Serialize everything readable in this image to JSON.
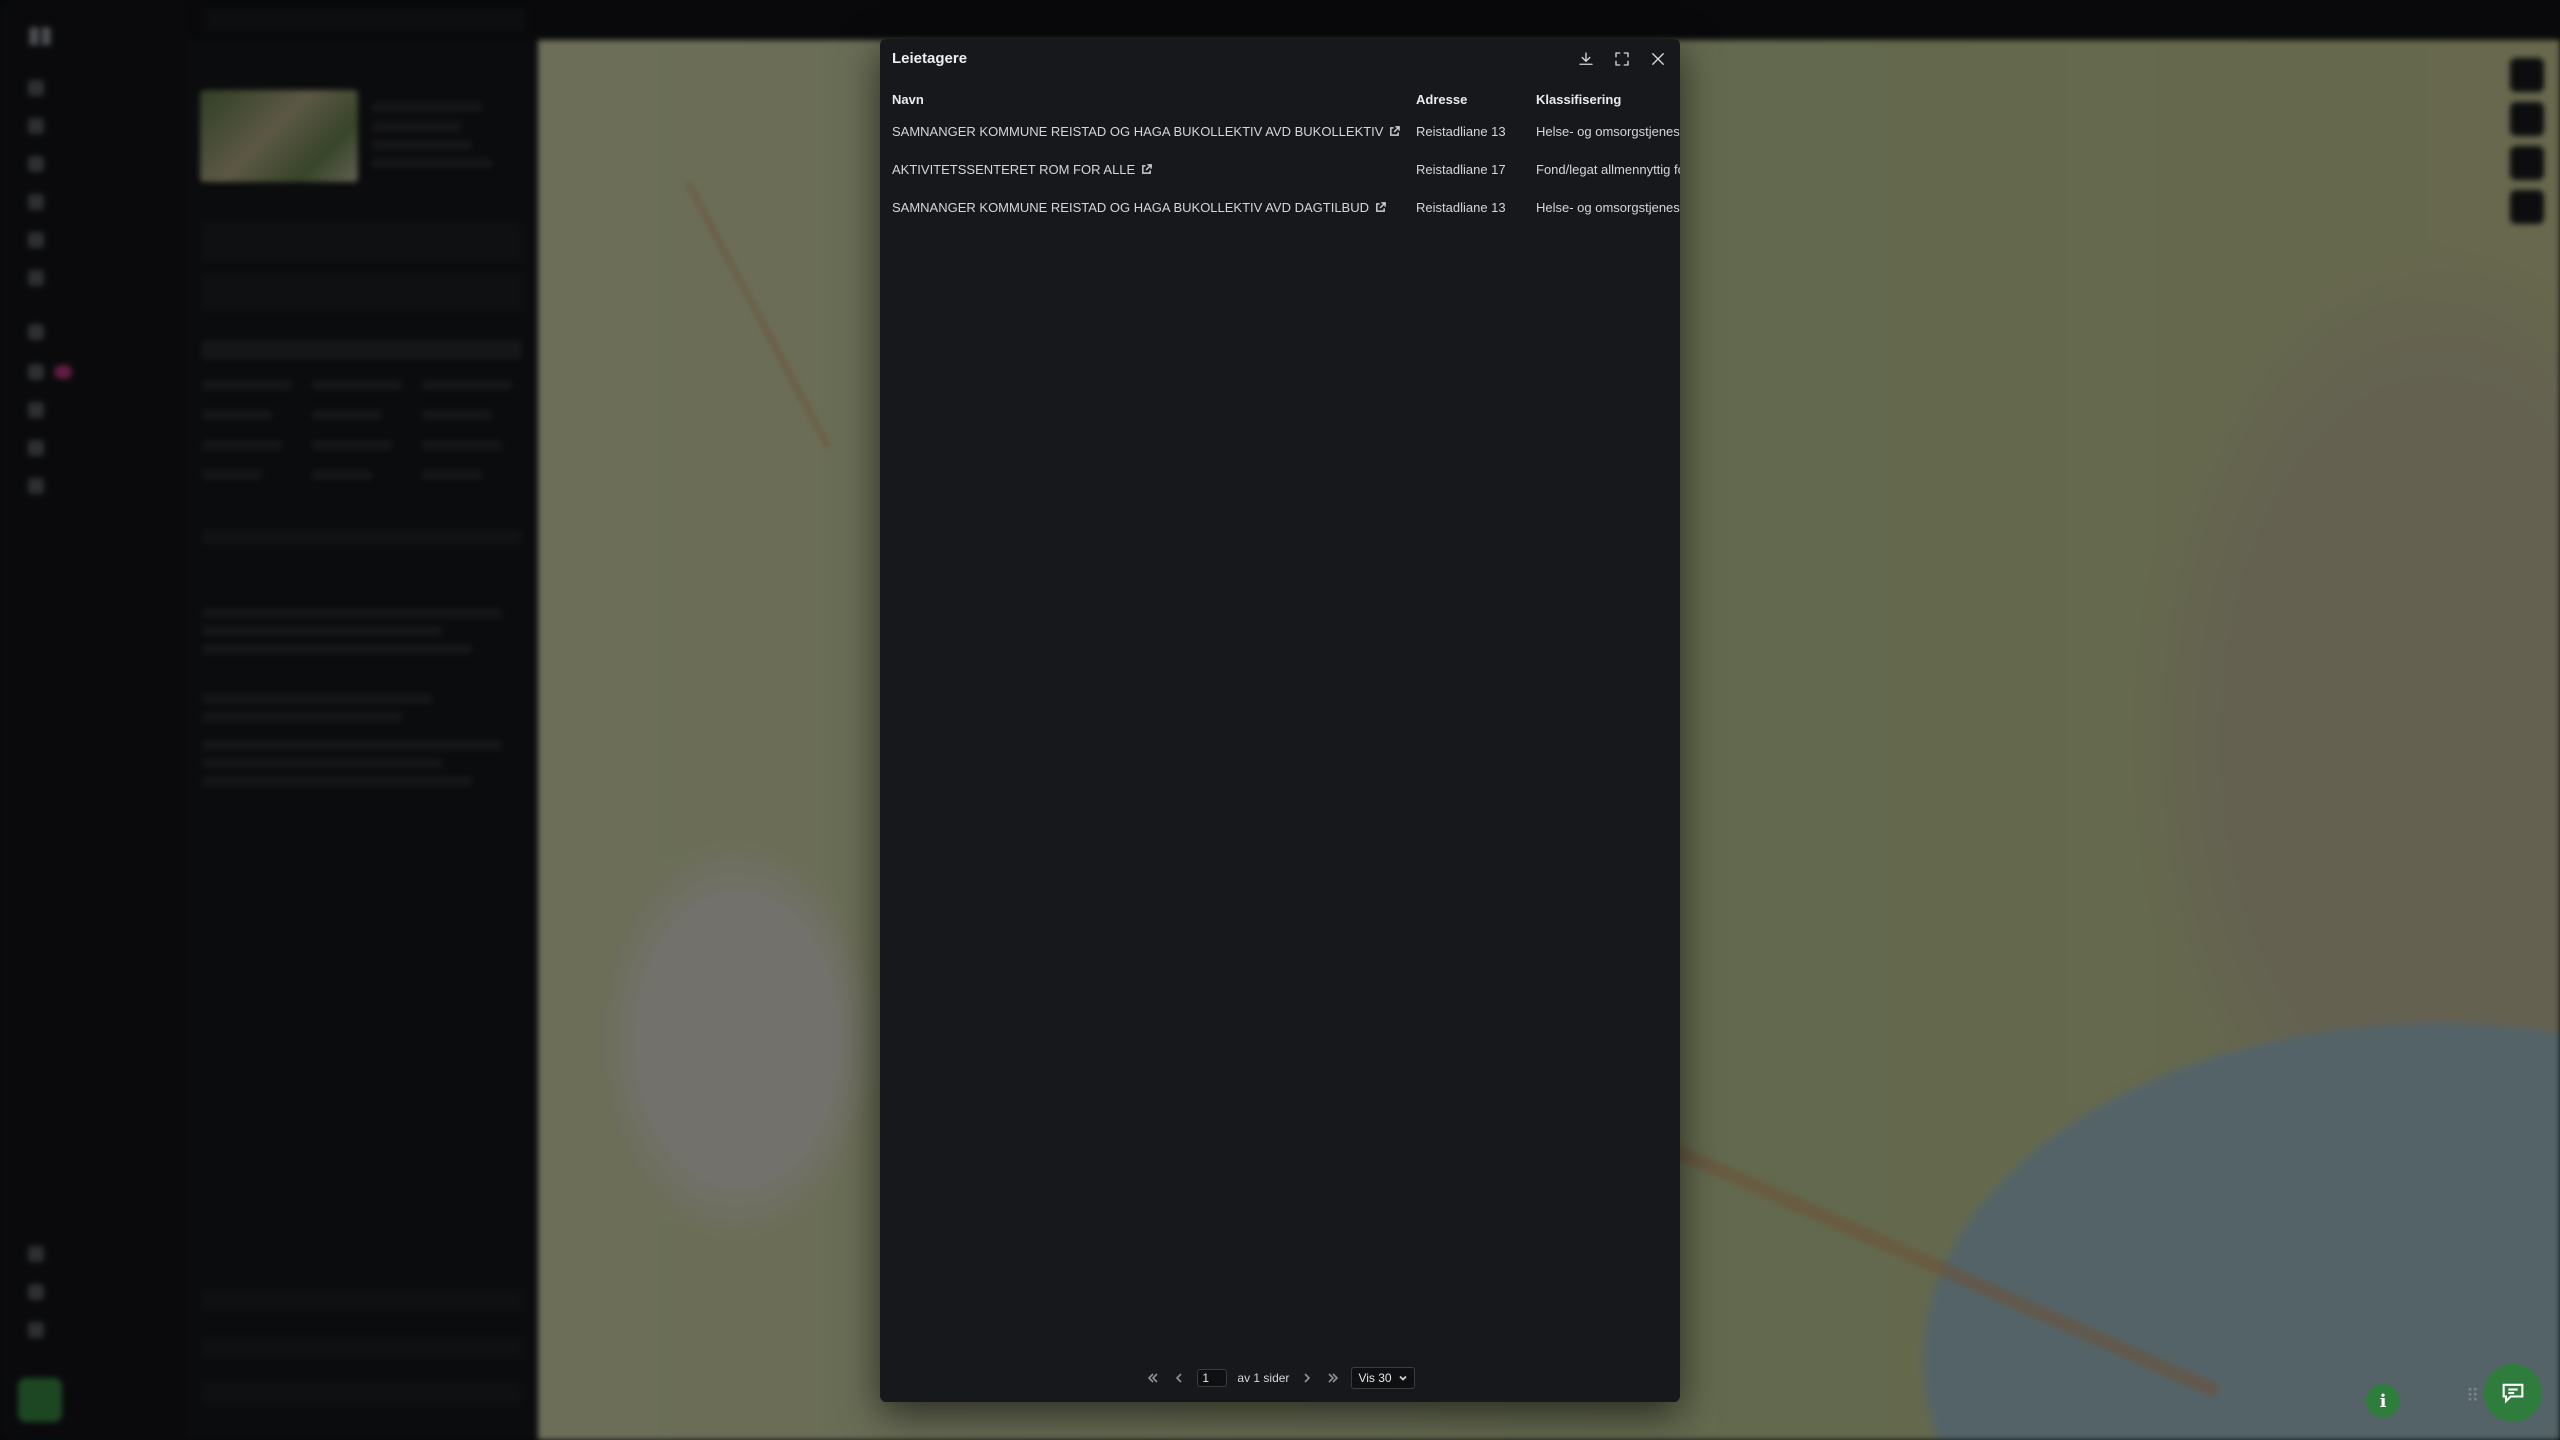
{
  "modal": {
    "title": "Leietagere",
    "columns": [
      "Navn",
      "Adresse",
      "Klassifisering"
    ],
    "rows": [
      {
        "navn": "SAMNANGER KOMMUNE REISTAD OG HAGA BUKOLLEKTIV AVD BUKOLLEKTIV",
        "adresse": "Reistadliane 13",
        "klassifisering": "Helse- og omsorgstjenester"
      },
      {
        "navn": "AKTIVITETSSENTERET ROM FOR ALLE",
        "adresse": "Reistadliane 17",
        "klassifisering": "Fond/legat allmennyttig formål"
      },
      {
        "navn": "SAMNANGER KOMMUNE REISTAD OG HAGA BUKOLLEKTIV AVD DAGTILBUD",
        "adresse": "Reistadliane 13",
        "klassifisering": "Helse- og omsorgstjenester"
      }
    ],
    "icons": {
      "download": "download-icon",
      "expand": "expand-icon",
      "close": "close-icon",
      "external": "external-link-icon"
    }
  },
  "pagination": {
    "page": "1",
    "of_label": "av 1 sider",
    "per_page_label": "Vis 30"
  },
  "colors": {
    "modal_bg": "#17181b",
    "accent_green": "#2f7d3c",
    "badge_pink": "#c13a86"
  }
}
